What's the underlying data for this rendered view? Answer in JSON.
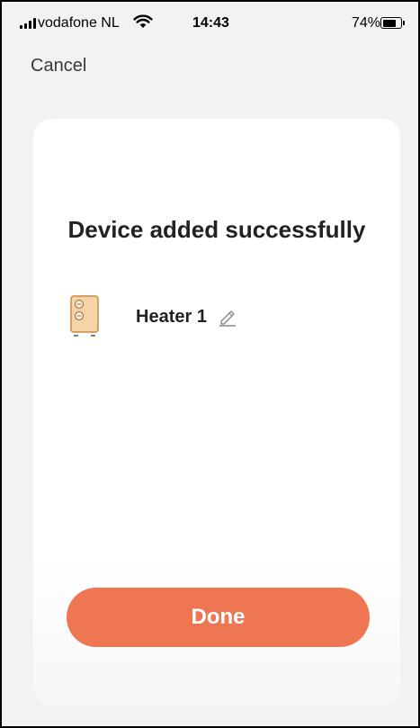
{
  "status_bar": {
    "carrier": "vodafone NL",
    "time": "14:43",
    "battery_percent": "74%",
    "battery_level": 0.74,
    "icons": [
      "signal-icon",
      "wifi-icon",
      "battery-icon"
    ]
  },
  "nav": {
    "cancel_label": "Cancel"
  },
  "result": {
    "title": "Device added successfully"
  },
  "device": {
    "name": "Heater 1",
    "icon": "heater-icon",
    "edit_icon": "pencil-icon"
  },
  "actions": {
    "done_label": "Done"
  },
  "colors": {
    "accent": "#ef7652",
    "background": "#f2f2f2",
    "card": "#ffffff",
    "heater_body": "#f5d4a8",
    "heater_outline": "#c98a44"
  }
}
